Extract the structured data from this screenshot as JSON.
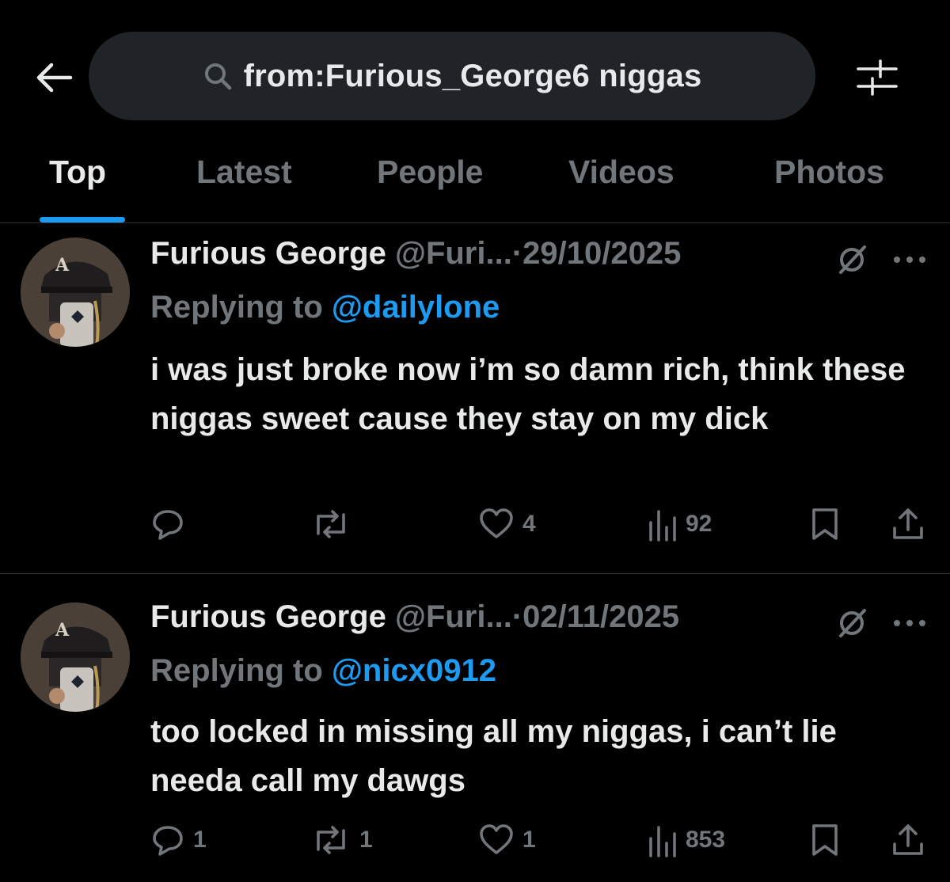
{
  "search": {
    "query": "from:Furious_George6 niggas"
  },
  "tabs": [
    {
      "label": "Top"
    },
    {
      "label": "Latest"
    },
    {
      "label": "People"
    },
    {
      "label": "Videos"
    },
    {
      "label": "Photos"
    }
  ],
  "tweets": [
    {
      "name": "Furious George",
      "handle": "@Furi...",
      "sep": "·",
      "date": "29/10/2025",
      "replying_label": "Replying to",
      "replying_to": "@dailylone",
      "text": "i was just broke now i’m so damn rich, think these niggas sweet cause they stay on my dick",
      "replies": "",
      "reposts": "",
      "likes": "4",
      "views": "92"
    },
    {
      "name": "Furious George",
      "handle": "@Furi...",
      "sep": "·",
      "date": "02/11/2025",
      "replying_label": "Replying to",
      "replying_to": "@nicx0912",
      "text": "too locked in missing all my niggas, i can’t lie needa call my dawgs",
      "replies": "1",
      "reposts": "1",
      "likes": "1",
      "views": "853"
    }
  ],
  "colors": {
    "background": "#000000",
    "text": "#e7e9ea",
    "muted": "#71767b",
    "accent": "#1d9bf0",
    "search_bg": "#202327",
    "divider": "#2f3336"
  },
  "icons": {
    "back": "arrow-left-icon",
    "search": "search-icon",
    "filter": "filter-sliders-icon",
    "grok": "grok-icon",
    "more": "more-dots-icon",
    "reply": "reply-icon",
    "repost": "repost-icon",
    "like": "heart-icon",
    "views": "views-chart-icon",
    "bookmark": "bookmark-icon",
    "share": "share-icon"
  }
}
